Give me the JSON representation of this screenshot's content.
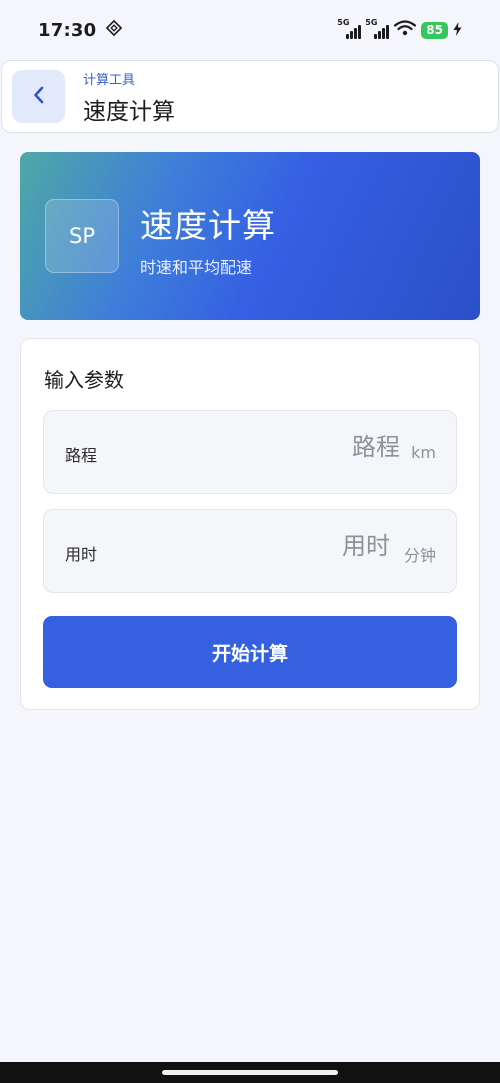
{
  "status_bar": {
    "time": "17:30",
    "signal1_label": "5G",
    "signal2_label": "5G",
    "battery": "85"
  },
  "header": {
    "breadcrumb": "计算工具",
    "title": "速度计算"
  },
  "hero": {
    "badge": "SP",
    "title": "速度计算",
    "subtitle": "时速和平均配速"
  },
  "form": {
    "section_title": "输入参数",
    "fields": [
      {
        "label": "路程",
        "value": "",
        "placeholder": "路程",
        "unit": "km"
      },
      {
        "label": "用时",
        "value": "",
        "placeholder": "用时",
        "unit": "分钟"
      }
    ],
    "submit_label": "开始计算"
  },
  "colors": {
    "accent": "#3561e1",
    "hero_gradient_start": "#4fa8a6",
    "hero_gradient_end": "#2c4fc9",
    "background": "#f4f6fb"
  },
  "icons": {
    "back": "chevron-left-icon",
    "status_extra": "nfc-diamond-icon",
    "wifi": "wifi-icon",
    "charging": "bolt-icon"
  }
}
